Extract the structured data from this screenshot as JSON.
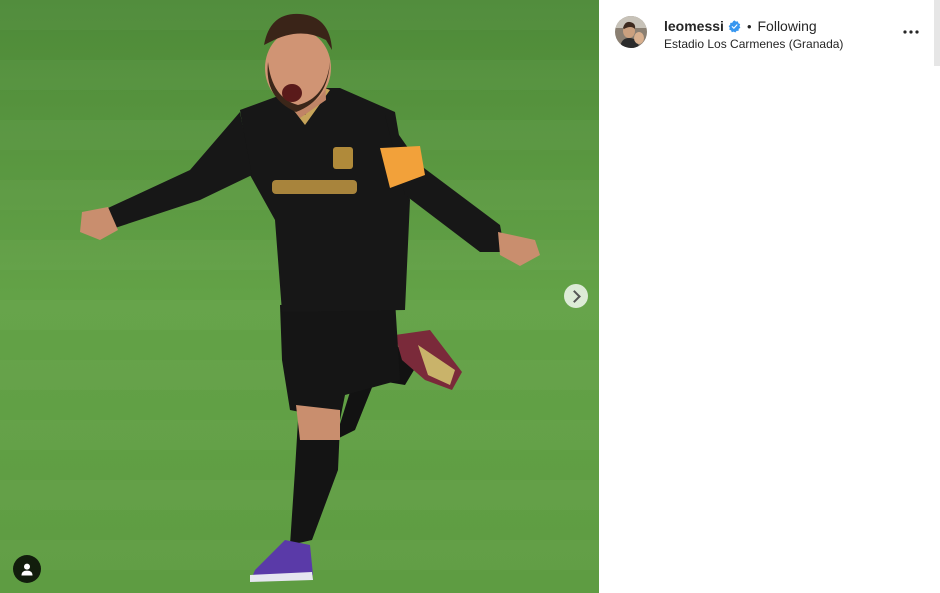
{
  "post": {
    "author": {
      "username": "leomessi",
      "verified": true,
      "avatar_icon": "profile-photo"
    },
    "follow_status": "Following",
    "separator": "•",
    "location": "Estadio Los Carmenes (Granada)",
    "media": {
      "next_icon": "chevron-right-icon",
      "tags_icon": "person-icon"
    },
    "more_icon": "more-horizontal-icon"
  },
  "colors": {
    "verified": "#3897f0",
    "text": "#262626",
    "pitch": "#5a9640"
  }
}
